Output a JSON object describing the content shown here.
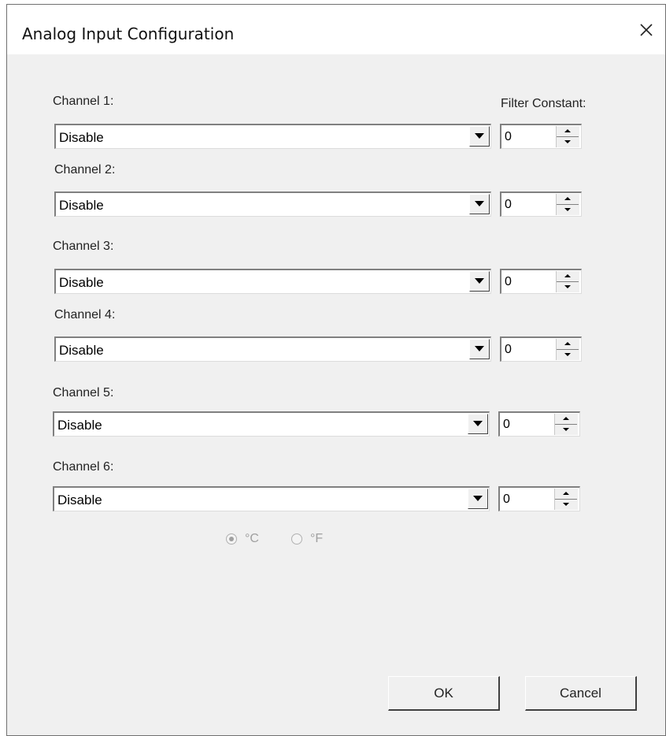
{
  "window": {
    "title": "Analog Input Configuration"
  },
  "filter_label": "Filter Constant:",
  "channels": [
    {
      "label": "Channel 1:",
      "mode": "Disable",
      "filter": "0"
    },
    {
      "label": "Channel 2:",
      "mode": "Disable",
      "filter": "0"
    },
    {
      "label": "Channel 3:",
      "mode": "Disable",
      "filter": "0"
    },
    {
      "label": "Channel 4:",
      "mode": "Disable",
      "filter": "0"
    },
    {
      "label": "Channel 5:",
      "mode": "Disable",
      "filter": "0"
    },
    {
      "label": "Channel 6:",
      "mode": "Disable",
      "filter": "0"
    }
  ],
  "units": {
    "celsius": {
      "label": "°C",
      "selected": true
    },
    "fahrenheit": {
      "label": "°F",
      "selected": false
    }
  },
  "buttons": {
    "ok": "OK",
    "cancel": "Cancel"
  },
  "icons": {
    "close": "close-icon",
    "dropdown": "dropdown-arrow-icon",
    "spin_up": "spin-up-icon",
    "spin_down": "spin-down-icon"
  }
}
